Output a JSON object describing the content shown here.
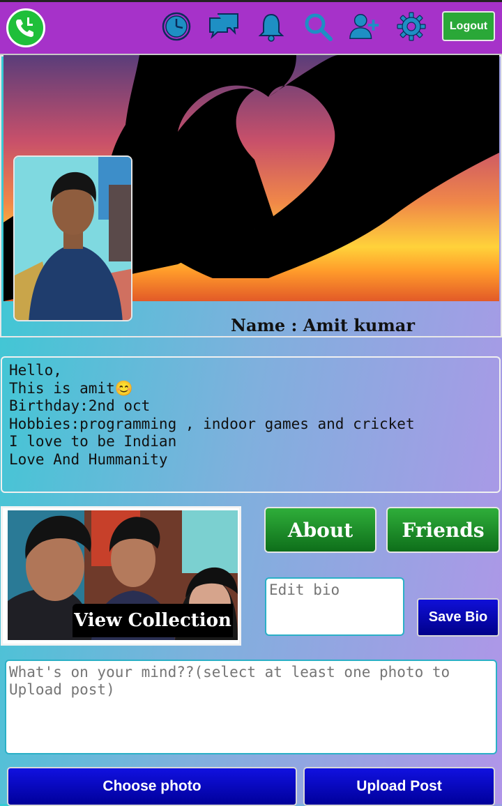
{
  "nav": {
    "icons": [
      "clock-icon",
      "chat-icon",
      "bell-icon",
      "search-icon",
      "add-friend-icon",
      "gear-icon"
    ],
    "logout_label": "Logout",
    "accent": "#a632c9"
  },
  "profile": {
    "name_label": "Name : Amit kumar"
  },
  "bio": {
    "lines": [
      "Hello,",
      "This is amit😊",
      "Birthday:2nd oct",
      "Hobbies:programming , indoor games and cricket",
      "I love to be Indian",
      "Love And Hummanity"
    ]
  },
  "collection": {
    "label": "View Collection"
  },
  "actions": {
    "about_label": "About",
    "friends_label": "Friends",
    "edit_bio_placeholder": "Edit bio",
    "save_bio_label": "Save Bio"
  },
  "post": {
    "placeholder": "What's on your mind??(select at least one photo to Upload post)",
    "choose_photo_label": "Choose photo",
    "upload_label": "Upload Post"
  }
}
